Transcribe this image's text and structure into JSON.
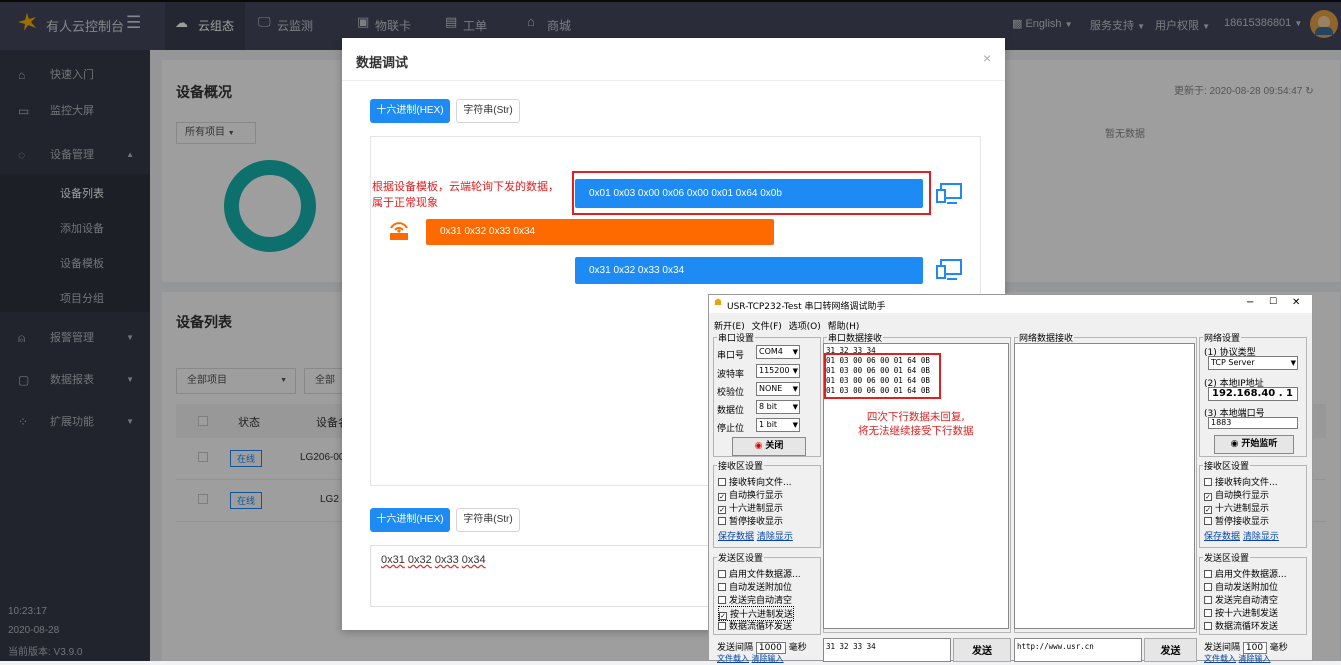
{
  "topbar": {
    "brand": "有人云控制台",
    "tabs": [
      "云组态",
      "云监测",
      "物联卡",
      "工单",
      "商城"
    ],
    "language": "English",
    "service": "服务支持",
    "permission": "用户权限",
    "user": "18615386801"
  },
  "sidebar": {
    "items": [
      {
        "label": "快速入门"
      },
      {
        "label": "监控大屏"
      },
      {
        "label": "设备管理"
      },
      {
        "label": "设备列表"
      },
      {
        "label": "添加设备"
      },
      {
        "label": "设备模板"
      },
      {
        "label": "项目分组"
      },
      {
        "label": "报警管理"
      },
      {
        "label": "数据报表"
      },
      {
        "label": "扩展功能"
      }
    ],
    "time": "10:23:17",
    "date": "2020-08-28",
    "version": "当前版本: V3.9.0"
  },
  "overview": {
    "title": "设备概况",
    "project_select": "所有项目",
    "updated": "更新于: 2020-08-28 09:54:47",
    "no_data": "暂无数据"
  },
  "device_list": {
    "title": "设备列表",
    "project_filter": "全部项目",
    "all_filter": "全部",
    "col_status": "状态",
    "col_device": "设备名",
    "rows": [
      {
        "status": "在线",
        "name": "LG206-00"
      },
      {
        "status": "在线",
        "name": "LG2"
      }
    ]
  },
  "modal": {
    "title": "数据调试",
    "hex_label": "十六进制(HEX)",
    "str_label": "字符串(Str)",
    "annotation_line1": "根据设备模板，云端轮询下发的数据，",
    "annotation_line2": "属于正常现象",
    "messages": [
      "0x01 0x03 0x00 0x06 0x00 0x01 0x64 0x0b",
      "0x31 0x32 0x33 0x34",
      "0x31 0x32 0x33 0x34"
    ],
    "input_bytes": [
      "0x31",
      "0x32",
      "0x33",
      "0x34"
    ],
    "colors": {
      "blue": "#1e8bf5",
      "orange": "#ff6a00",
      "red": "#e02020"
    }
  },
  "usr": {
    "title": "USR-TCP232-Test 串口转网络调试助手",
    "menu": [
      "新开(E)",
      "文件(F)",
      "选项(O)",
      "帮助(H)"
    ],
    "serial_legend": "串口设置",
    "port_label": "串口号",
    "port_value": "COM4",
    "baud_label": "波特率",
    "baud_value": "115200",
    "parity_label": "校验位",
    "parity_value": "NONE",
    "data_label": "数据位",
    "data_value": "8 bit",
    "stop_label": "停止位",
    "stop_value": "1 bit",
    "close_button": "关闭",
    "recv_legend": "接收区设置",
    "recv_opts": [
      "接收转向文件...",
      "自动换行显示",
      "十六进制显示",
      "暂停接收显示"
    ],
    "recv_checked": [
      false,
      true,
      true,
      false
    ],
    "save_data": "保存数据",
    "clear_display": "清除显示",
    "send_legend": "发送区设置",
    "send_opts_left": [
      "启用文件数据源...",
      "自动发送附加位",
      "发送完自动清空",
      "按十六进制发送",
      "数据流循环发送"
    ],
    "send_checked_left": [
      false,
      false,
      false,
      true,
      false
    ],
    "send_opts_right": [
      "启用文件数据源...",
      "自动发送附加位",
      "发送完自动清空",
      "按十六进制发送",
      "数据流循环发送"
    ],
    "interval_label": "发送间隔",
    "interval_left": "1000",
    "interval_right": "100",
    "ms": "毫秒",
    "file_load": "文件载入",
    "clear_input": "清除输入",
    "serial_recv_legend": "串口数据接收",
    "net_recv_legend": "网络数据接收",
    "recv_lines": [
      "31 32 33 34",
      "01 03 00 06 00 01 64 0B",
      "01 03 00 06 00 01 64 0B",
      "01 03 00 06 00 01 64 0B",
      "01 03 00 06 00 01 64 0B"
    ],
    "note_line1": "四次下行数据未回复,",
    "note_line2": "将无法继续接受下行数据",
    "net_legend": "网络设置",
    "proto_label": "(1) 协议类型",
    "proto_value": "TCP Server",
    "ip_label": "(2) 本地IP地址",
    "ip_value": "192.168.40 . 1",
    "port2_label": "(3) 本地端口号",
    "port2_value": "1883",
    "listen_button": "开始监听",
    "send_serial": "31 32 33 34",
    "send_net": "http://www.usr.cn",
    "send_btn": "发送"
  }
}
